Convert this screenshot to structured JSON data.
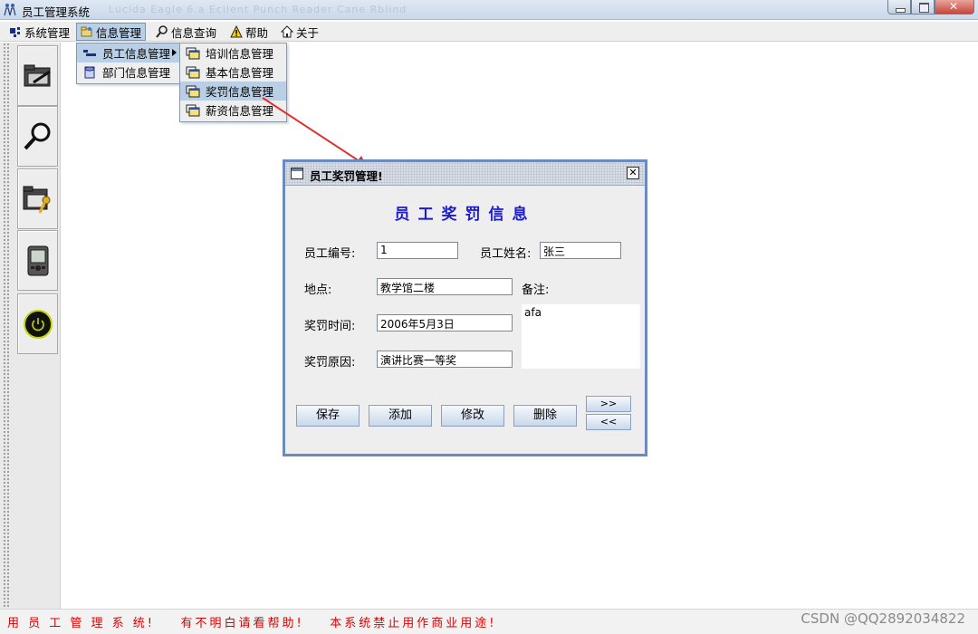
{
  "window": {
    "title": "员工管理系统",
    "ghost_text": "Lucida Eagle 6.a Ecilent Punch Reader Cane Rblindfolds Ruthn"
  },
  "menubar": [
    {
      "label": "系统管理",
      "icon": "system-grid-icon"
    },
    {
      "label": "信息管理",
      "icon": "info-folder-icon"
    },
    {
      "label": "信息查询",
      "icon": "magnifier-icon"
    },
    {
      "label": "帮助",
      "icon": "warning-triangle-icon"
    },
    {
      "label": "关于",
      "icon": "house-icon"
    }
  ],
  "info_menu": [
    {
      "label": "员工信息管理",
      "icon": "employee-bar-icon"
    },
    {
      "label": "部门信息管理",
      "icon": "department-cylinder-icon"
    }
  ],
  "employee_submenu": [
    {
      "label": "培训信息管理",
      "icon": "stacked-windows-icon"
    },
    {
      "label": "基本信息管理",
      "icon": "stacked-windows-icon"
    },
    {
      "label": "奖罚信息管理",
      "icon": "stacked-windows-icon"
    },
    {
      "label": "薪资信息管理",
      "icon": "stacked-windows-icon"
    }
  ],
  "toolbar": [
    {
      "name": "folder-edit-icon"
    },
    {
      "name": "search-magnifier-icon"
    },
    {
      "name": "folder-key-icon"
    },
    {
      "name": "handheld-device-icon"
    },
    {
      "name": "power-icon"
    }
  ],
  "dialog": {
    "title": "员工奖罚管理!",
    "heading": "员工奖罚信息",
    "labels": {
      "emp_id": "员工编号:",
      "emp_name": "员工姓名:",
      "place": "地点:",
      "note": "备注:",
      "time": "奖罚时间:",
      "reason": "奖罚原因:"
    },
    "values": {
      "emp_id": "1",
      "emp_name": "张三",
      "place": "教学馆二楼",
      "time": "2006年5月3日",
      "reason": "演讲比赛一等奖",
      "note": "afa"
    },
    "buttons": {
      "save": "保存",
      "add": "添加",
      "edit": "修改",
      "delete": "删除",
      "next": ">>",
      "prev": "<<"
    }
  },
  "status": {
    "message": "用 员 工 管 理 系 统!    有不明白请看帮助!    本系统禁止用作商业用途!",
    "watermark": "CSDN @QQ2892034822"
  }
}
